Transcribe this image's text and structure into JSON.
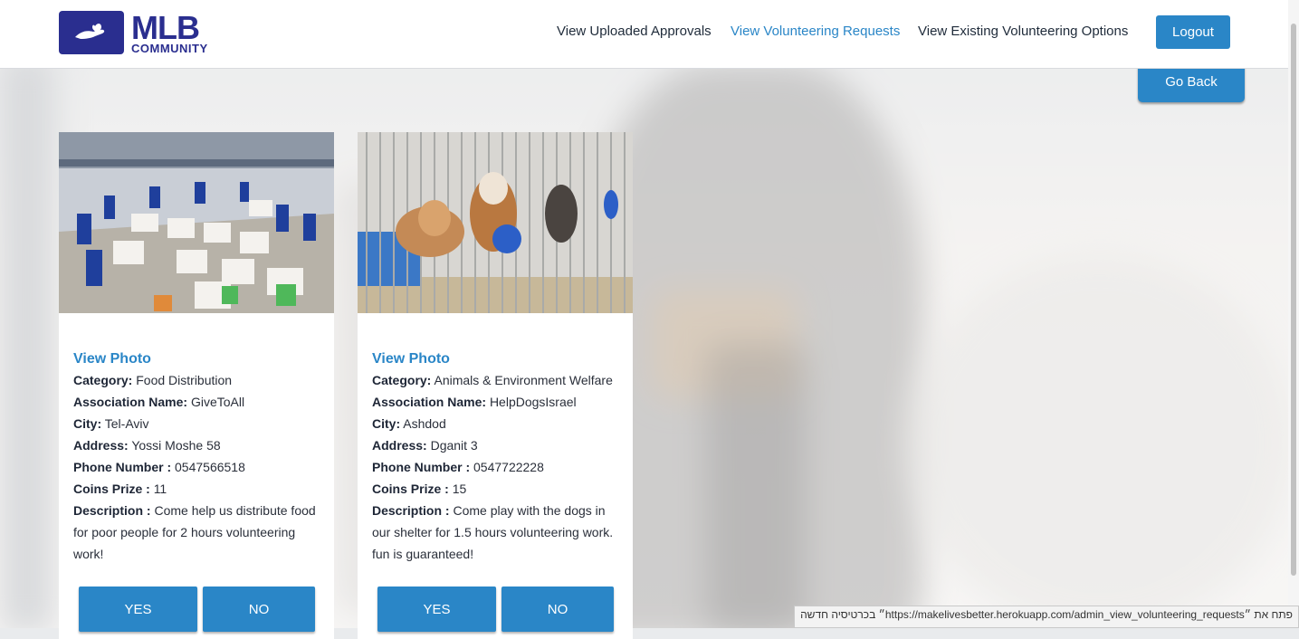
{
  "logo": {
    "main": "MLB",
    "sub": "COMMUNITY"
  },
  "nav": {
    "links": [
      {
        "label": "View Uploaded Approvals",
        "active": false
      },
      {
        "label": "View Volunteering Requests",
        "active": true
      },
      {
        "label": "View Existing Volunteering Options",
        "active": false
      }
    ],
    "logout": "Logout"
  },
  "go_back": "Go Back",
  "labels": {
    "view_photo": "View Photo",
    "category": "Category:",
    "association": "Association Name:",
    "city": "City:",
    "address": "Address:",
    "phone": "Phone Number :",
    "coins": "Coins Prize :",
    "description": "Description :",
    "yes": "YES",
    "no": "NO"
  },
  "requests": [
    {
      "category": "Food Distribution",
      "association": "GiveToAll",
      "city": "Tel-Aviv",
      "address": "Yossi Moshe 58",
      "phone": "0547566518",
      "coins": "11",
      "description": "Come help us distribute food for poor people for 2 hours volunteering work!"
    },
    {
      "category": "Animals & Environment Welfare",
      "association": "HelpDogsIsrael",
      "city": "Ashdod",
      "address": "Dganit 3",
      "phone": "0547722228",
      "coins": "15",
      "description": "Come play with the dogs in our shelter for 1.5 hours volunteering work. fun is guaranteed!"
    }
  ],
  "status_bar": "פתח את ״https://makelivesbetter.herokuapp.com/admin_view_volunteering_requests״ בכרטיסיה חדשה"
}
